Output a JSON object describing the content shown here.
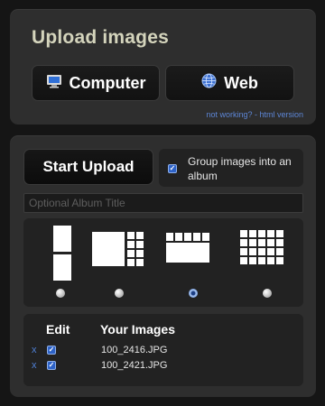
{
  "header": {
    "title": "Upload images"
  },
  "sources": {
    "computer_label": "Computer",
    "web_label": "Web",
    "fallback_link": "not working? - html version"
  },
  "upload": {
    "start_label": "Start Upload",
    "group_label": "Group images into an album",
    "group_checked": true,
    "album_title_placeholder": "Optional Album Title",
    "album_title_value": ""
  },
  "layouts": {
    "options": [
      "single-column",
      "large-plus-grid",
      "wide-strip",
      "small-grid"
    ],
    "selected": "wide-strip"
  },
  "images": {
    "edit_header": "Edit",
    "list_header": "Your Images",
    "remove_glyph": "x",
    "files": [
      {
        "name": "100_2416.JPG",
        "checked": true
      },
      {
        "name": "100_2421.JPG",
        "checked": true
      }
    ]
  },
  "colors": {
    "accent": "#2d62c7",
    "link": "#5d86d6",
    "title": "#d4d4bc"
  },
  "icons": {
    "computer": "monitor-icon",
    "web": "globe-icon"
  }
}
